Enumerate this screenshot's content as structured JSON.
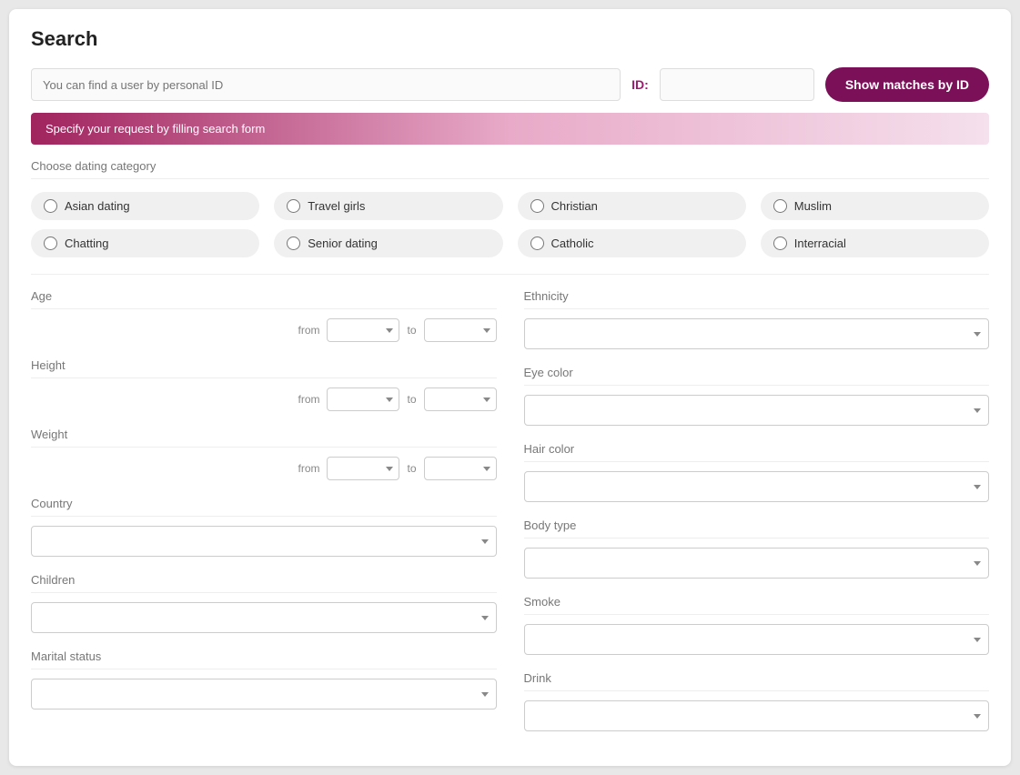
{
  "page": {
    "title": "Search",
    "banner_text": "Specify your request by filling search form",
    "id_label": "ID:",
    "show_matches_label": "Show matches by ID",
    "search_hint": "You can find a user by personal ID"
  },
  "categories": {
    "section_label": "Choose dating category",
    "items": [
      {
        "id": "asian",
        "label": "Asian dating"
      },
      {
        "id": "travel",
        "label": "Travel girls"
      },
      {
        "id": "christian",
        "label": "Christian"
      },
      {
        "id": "muslim",
        "label": "Muslim"
      },
      {
        "id": "chatting",
        "label": "Chatting"
      },
      {
        "id": "senior",
        "label": "Senior dating"
      },
      {
        "id": "catholic",
        "label": "Catholic"
      },
      {
        "id": "interracial",
        "label": "Interracial"
      }
    ]
  },
  "filters": {
    "left": [
      {
        "id": "age",
        "label": "Age",
        "type": "range"
      },
      {
        "id": "height",
        "label": "Height",
        "type": "range"
      },
      {
        "id": "weight",
        "label": "Weight",
        "type": "range"
      },
      {
        "id": "country",
        "label": "Country",
        "type": "select"
      },
      {
        "id": "children",
        "label": "Children",
        "type": "select"
      },
      {
        "id": "marital_status",
        "label": "Marital status",
        "type": "select"
      }
    ],
    "right": [
      {
        "id": "ethnicity",
        "label": "Ethnicity",
        "type": "select"
      },
      {
        "id": "eye_color",
        "label": "Eye color",
        "type": "select"
      },
      {
        "id": "hair_color",
        "label": "Hair color",
        "type": "select"
      },
      {
        "id": "body_type",
        "label": "Body type",
        "type": "select"
      },
      {
        "id": "smoke",
        "label": "Smoke",
        "type": "select"
      },
      {
        "id": "drink",
        "label": "Drink",
        "type": "select"
      }
    ]
  }
}
